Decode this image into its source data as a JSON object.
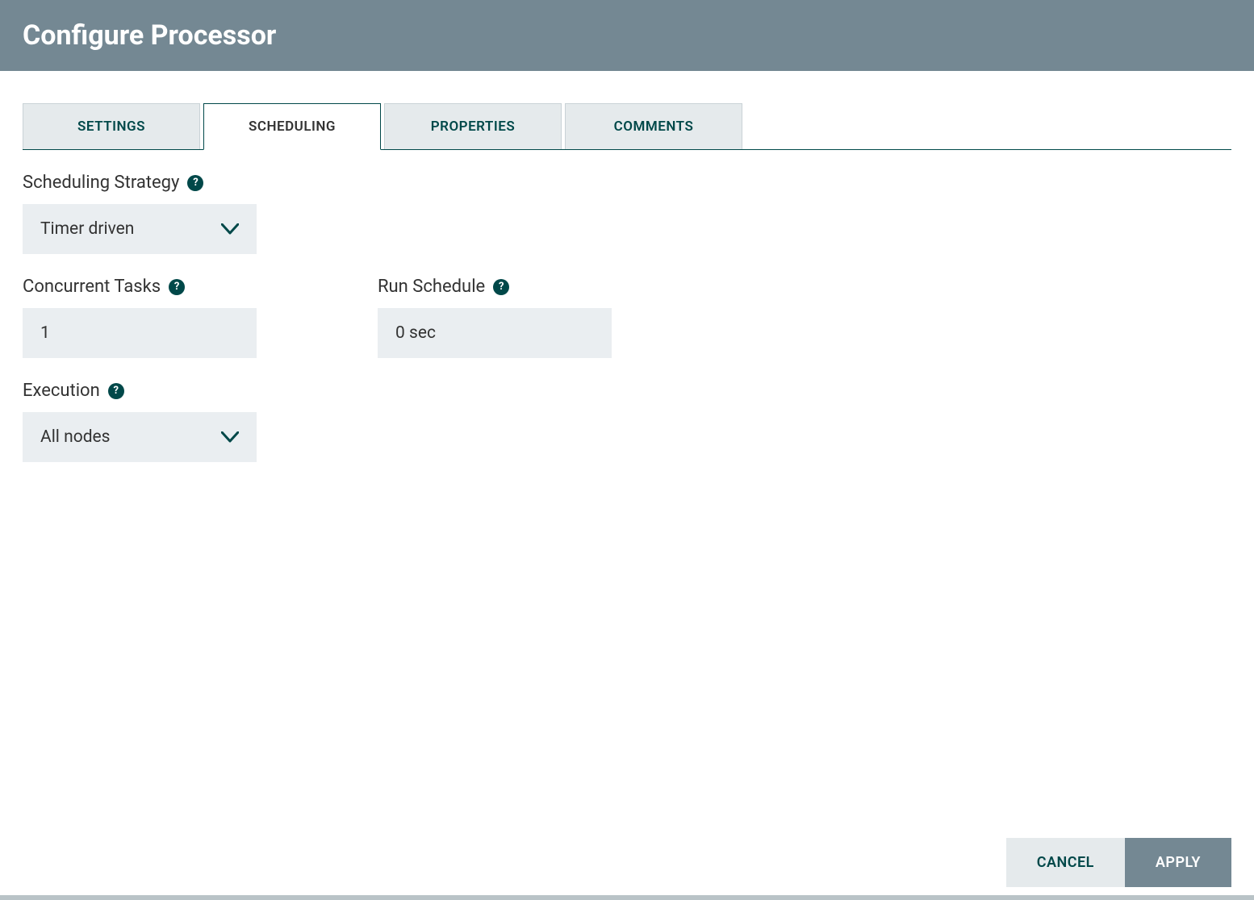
{
  "header": {
    "title": "Configure Processor"
  },
  "tabs": {
    "settings": "SETTINGS",
    "scheduling": "SCHEDULING",
    "properties": "PROPERTIES",
    "comments": "COMMENTS"
  },
  "form": {
    "scheduling_strategy": {
      "label": "Scheduling Strategy",
      "value": "Timer driven"
    },
    "concurrent_tasks": {
      "label": "Concurrent Tasks",
      "value": "1"
    },
    "run_schedule": {
      "label": "Run Schedule",
      "value": "0 sec"
    },
    "execution": {
      "label": "Execution",
      "value": "All nodes"
    }
  },
  "footer": {
    "cancel": "CANCEL",
    "apply": "APPLY"
  }
}
